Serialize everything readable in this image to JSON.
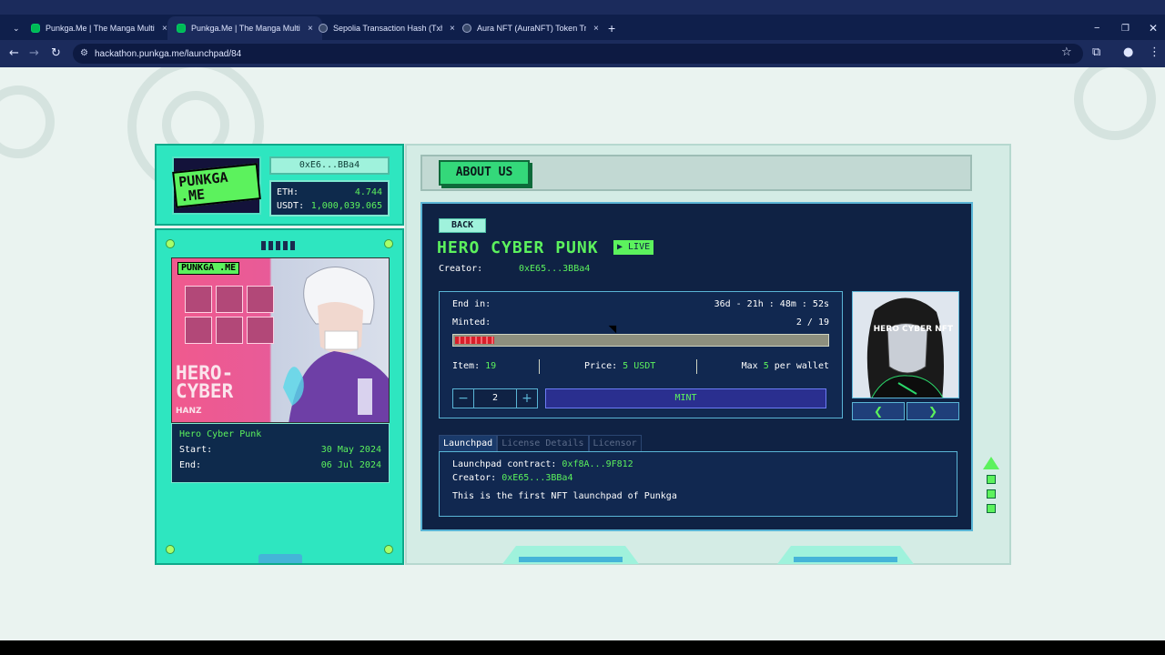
{
  "browser": {
    "tabs": [
      {
        "title": "Punkga.Me | The Manga Multiv",
        "active": false
      },
      {
        "title": "Punkga.Me | The Manga Multiv",
        "active": true
      },
      {
        "title": "Sepolia Transaction Hash (Txhas",
        "active": false
      },
      {
        "title": "Aura NFT (AuraNFT) Token Trac",
        "active": false
      }
    ],
    "new_tab": "+",
    "close": "×",
    "url": "hackathon.punkga.me/launchpad/84"
  },
  "account": {
    "logo_text": "PUNKGA .ME",
    "address": "0xE6...BBa4",
    "eth_label": "ETH:",
    "eth_value": "4.744",
    "usdt_label": "USDT:",
    "usdt_value": "1,000,039.065"
  },
  "collection": {
    "cover_logo": "PUNKGA .ME",
    "cover_title_1": "HERO-",
    "cover_title_2": "CYBER",
    "cover_author": "HANZ",
    "name": "Hero Cyber Punk",
    "start_label": "Start:",
    "start_value": "30 May 2024",
    "end_label": "End:",
    "end_value": "06 Jul 2024"
  },
  "main": {
    "about_button": "ABOUT US",
    "back_button": "BACK",
    "title": "HERO CYBER PUNK",
    "live_badge": "▶ LIVE",
    "creator_label": "Creator:",
    "creator_value": "0xE65...3BBa4",
    "end_in_label": "End in:",
    "end_in_value": "36d - 21h : 48m : 52s",
    "minted_label": "Minted:",
    "minted_value": "2 / 19",
    "minted_progress": 0.105,
    "item_label": "Item:",
    "item_value": "19",
    "price_label": "Price:",
    "price_value": "5 USDT",
    "max_label": "Max",
    "max_value": "5",
    "max_suffix": "per wallet",
    "qty_minus": "−",
    "qty_value": "2",
    "qty_plus": "+",
    "mint_button": "MINT",
    "nft_label": "HERO CYBER NFT",
    "nav_prev": "❮",
    "nav_next": "❯",
    "tabs": [
      "Launchpad",
      "License Details",
      "Licensor"
    ],
    "details": {
      "contract_label": "Launchpad contract:",
      "contract_value": "0xf8A...9F812",
      "creator_label": "Creator:",
      "creator_value": "0xE65...3BBa4",
      "description": "This is the first NFT launchpad of Punkga"
    }
  }
}
